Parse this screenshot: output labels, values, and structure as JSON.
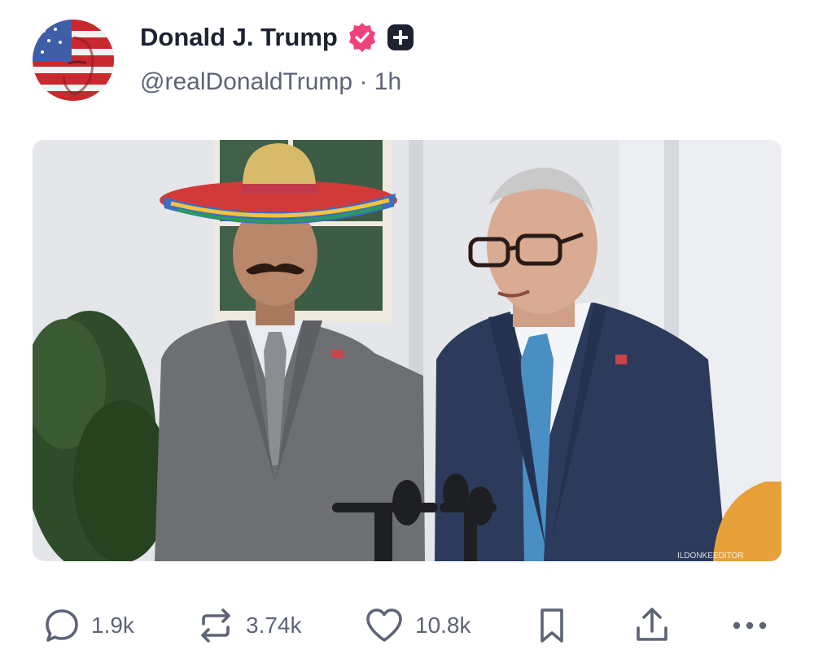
{
  "author": {
    "display_name": "Donald J. Trump",
    "handle": "@realDonaldTrump",
    "separator": "·",
    "time_ago": "1h",
    "verified_badge_icon": "verified-badge-icon",
    "verified_badge_color": "#f0427a",
    "plus_badge_icon": "plus-badge-icon"
  },
  "media": {
    "watermark": "ILDONKEEDITOR"
  },
  "actions": {
    "replies": "1.9k",
    "reposts": "3.74k",
    "likes": "10.8k",
    "icons": [
      "reply-icon",
      "repost-icon",
      "like-icon",
      "bookmark-icon",
      "share-icon",
      "more-icon"
    ]
  },
  "colors": {
    "text_primary": "#1d2230",
    "text_secondary": "#5e6476",
    "icon_color": "#5e6476"
  }
}
